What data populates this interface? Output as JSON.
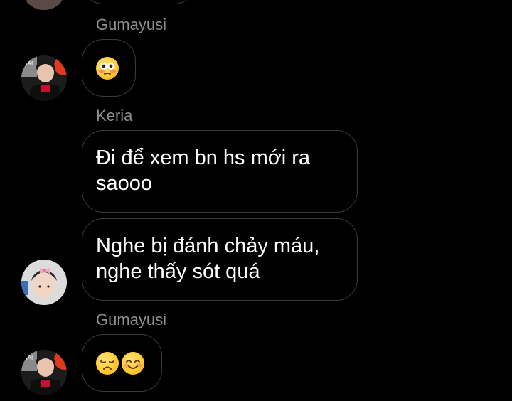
{
  "colors": {
    "background": "#000000",
    "bubble_border": "#3a3a3c",
    "sender_text": "#8e8e93",
    "message_text": "#ffffff"
  },
  "messages": [
    {
      "sender": "Gumayusi",
      "text": "",
      "emoji": [
        "flushed-face-emoji"
      ]
    },
    {
      "sender": "Keria",
      "text": "Đi để xem bn hs mới ra\nsaooo"
    },
    {
      "sender": "",
      "text": "Nghe bị đánh chảy máu,\nnghe thấy sót quá"
    },
    {
      "sender": "Gumayusi",
      "text": "",
      "emoji": [
        "disappointed-face-emoji",
        "smiling-face-emoji"
      ]
    }
  ]
}
